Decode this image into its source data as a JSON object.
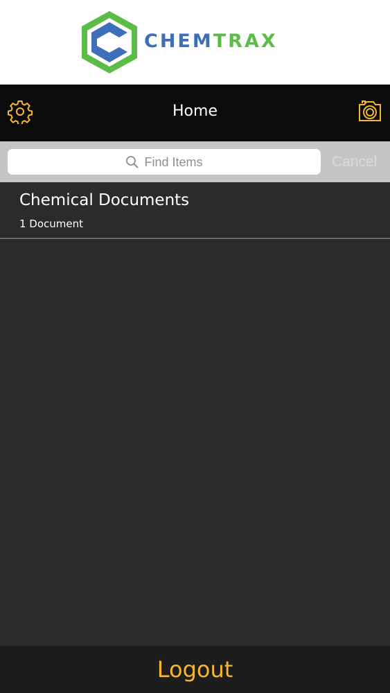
{
  "brand": {
    "logo_text_part1": "CHEM",
    "logo_text_part2": "TRAX",
    "logo_icon": "chemtrax-hexagon-logo",
    "colors": {
      "blue": "#3f6fb8",
      "green": "#5bbd48"
    }
  },
  "nav": {
    "title": "Home",
    "left_icon": "gear-icon",
    "right_icon": "camera-icon",
    "accent_color": "#f5b731"
  },
  "search": {
    "placeholder": "Find Items",
    "cancel_label": "Cancel",
    "icon": "search-icon"
  },
  "items": [
    {
      "title": "Chemical Documents",
      "subtitle": "1 Document"
    }
  ],
  "footer": {
    "logout_label": "Logout"
  }
}
